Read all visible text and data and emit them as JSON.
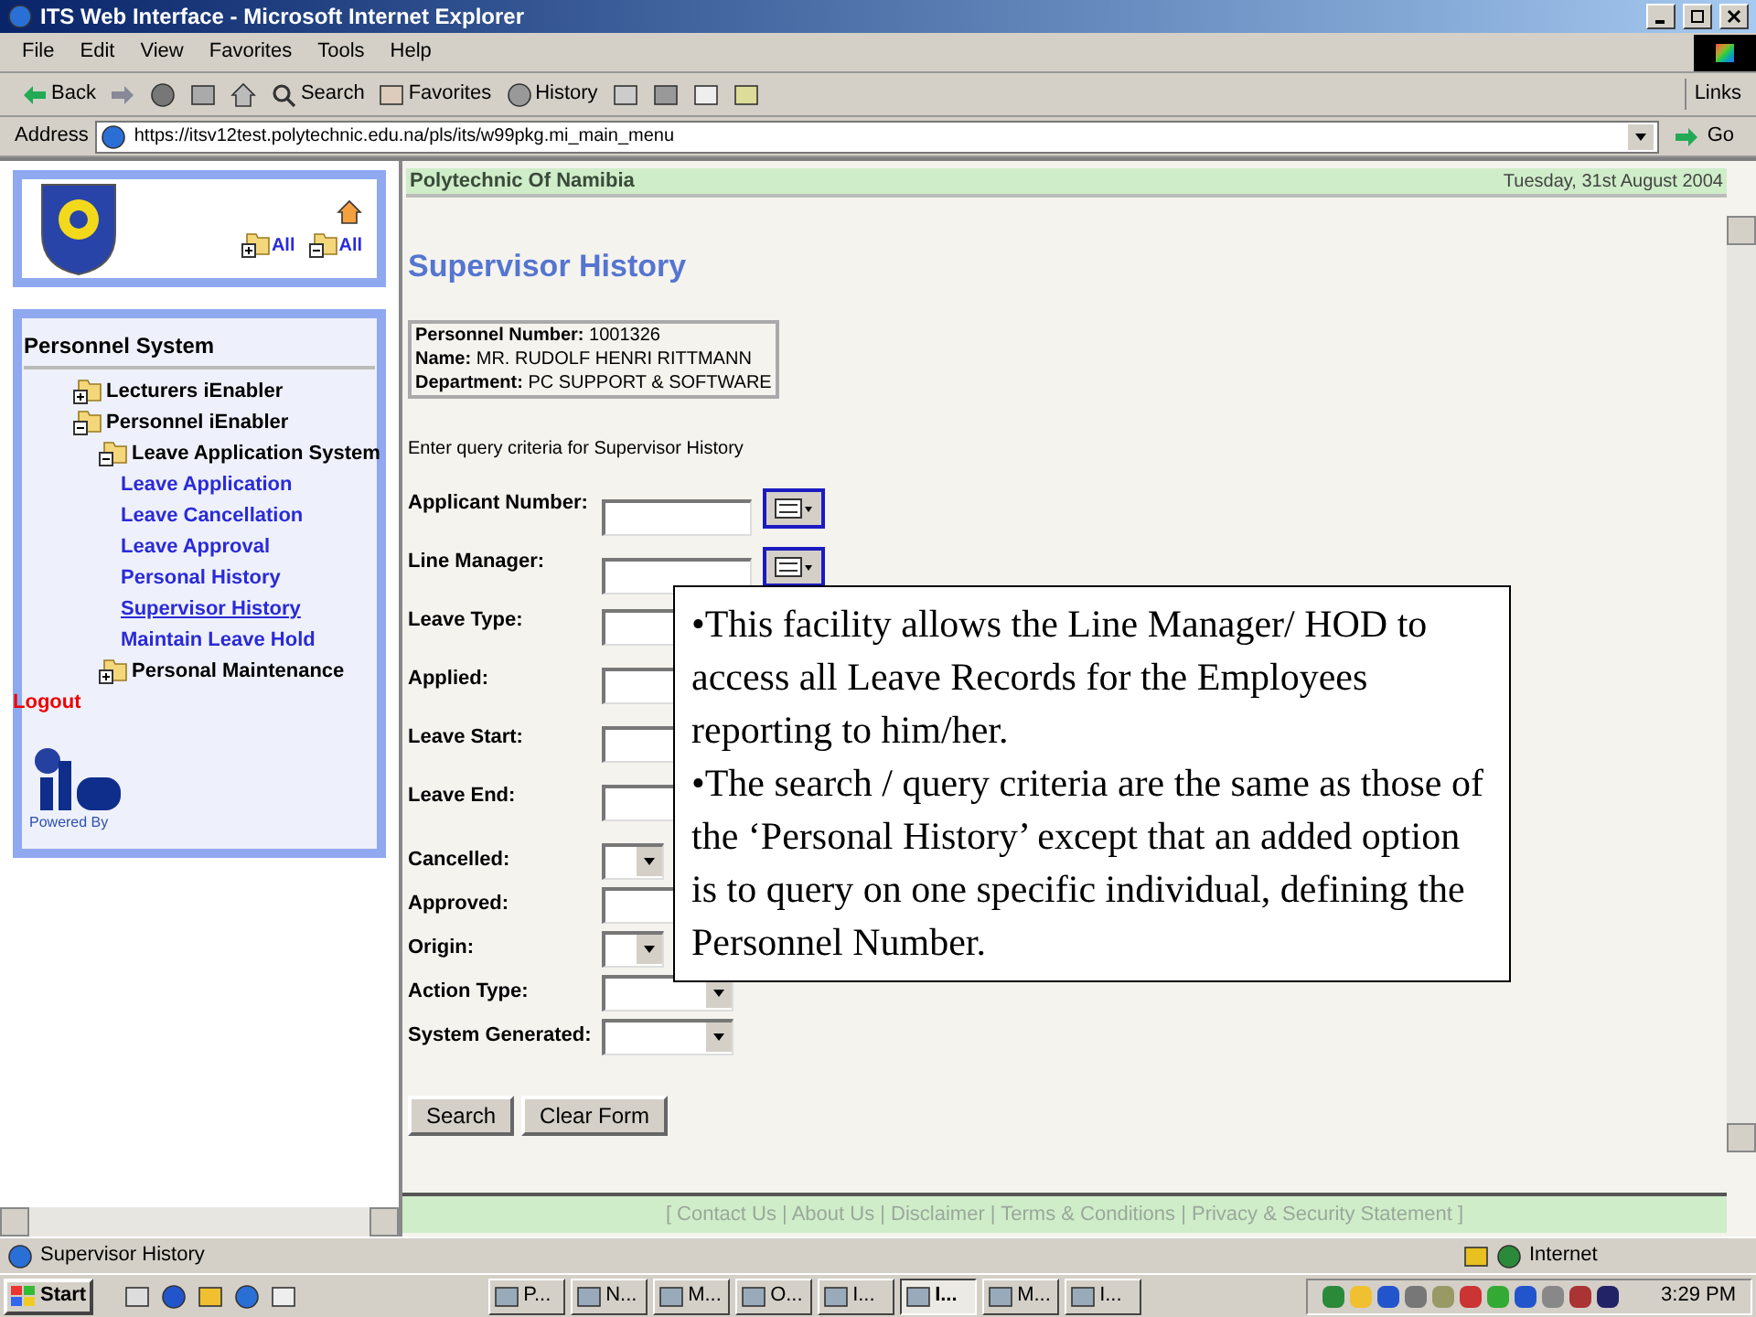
{
  "window": {
    "title": "ITS Web Interface - Microsoft Internet Explorer"
  },
  "menu": [
    "File",
    "Edit",
    "View",
    "Favorites",
    "Tools",
    "Help"
  ],
  "toolbar": [
    {
      "kind": "back",
      "label": "Back"
    },
    {
      "kind": "forward"
    },
    {
      "kind": "stop"
    },
    {
      "kind": "refresh"
    },
    {
      "kind": "home"
    },
    {
      "kind": "search",
      "label": "Search"
    },
    {
      "kind": "favorites",
      "label": "Favorites"
    },
    {
      "kind": "history",
      "label": "History"
    },
    {
      "kind": "mail"
    },
    {
      "kind": "print"
    },
    {
      "kind": "edit"
    },
    {
      "kind": "discuss"
    }
  ],
  "links": "Links",
  "address": {
    "label": "Address",
    "url": "https://itsv12test.polytechnic.edu.na/pls/its/w99pkg.mi_main_menu",
    "go": "Go"
  },
  "sidebar": {
    "expand_all": "All",
    "collapse_all": "All",
    "title": "Personnel System",
    "tree": [
      {
        "kind": "folder",
        "label": "Lecturers iEnabler",
        "expanded": false
      },
      {
        "kind": "folder",
        "label": "Personnel iEnabler",
        "expanded": true,
        "children": [
          {
            "kind": "folder",
            "label": "Leave Application System",
            "expanded": true,
            "children": [
              {
                "kind": "link",
                "label": "Leave Application",
                "selected": false
              },
              {
                "kind": "link",
                "label": "Leave Cancellation",
                "selected": false
              },
              {
                "kind": "link",
                "label": "Leave Approval",
                "selected": false
              },
              {
                "kind": "link",
                "label": "Personal History",
                "selected": false
              },
              {
                "kind": "link",
                "label": "Supervisor History",
                "selected": true
              },
              {
                "kind": "link",
                "label": "Maintain Leave Hold",
                "selected": false
              }
            ]
          },
          {
            "kind": "folder",
            "label": "Personal Maintenance",
            "expanded": false
          }
        ]
      }
    ],
    "logout": "Logout",
    "powered_by": "Powered By"
  },
  "main": {
    "org": "Polytechnic Of Namibia",
    "date": "Tuesday, 31st August 2004",
    "page_title": "Supervisor History",
    "info": [
      {
        "label": "Personnel Number:",
        "value": "1001326"
      },
      {
        "label": "Name:",
        "value": "MR. RUDOLF HENRI RITTMANN"
      },
      {
        "label": "Department:",
        "value": "PC SUPPORT & SOFTWARE"
      }
    ],
    "instruction": "Enter query criteria for Supervisor History",
    "fields": [
      {
        "label": "Applicant Number:",
        "kind": "lookup"
      },
      {
        "label": "Line Manager:",
        "kind": "lookup"
      },
      {
        "label": "Leave Type:",
        "kind": "text"
      },
      {
        "label": "Applied:",
        "kind": "text"
      },
      {
        "label": "Leave Start:",
        "kind": "text"
      },
      {
        "label": "Leave End:",
        "kind": "text"
      },
      {
        "label": "Cancelled:",
        "kind": "select_narrow"
      },
      {
        "label": "Approved:",
        "kind": "text_small"
      },
      {
        "label": "Origin:",
        "kind": "select_narrow"
      },
      {
        "label": "Action Type:",
        "kind": "select"
      },
      {
        "label": "System Generated:",
        "kind": "select"
      }
    ],
    "buttons": [
      "Search",
      "Clear Form"
    ],
    "footer": "[ Contact Us | About Us | Disclaimer | Terms & Conditions | Privacy & Security Statement ]"
  },
  "callout": [
    "•This facility allows the Line Manager/ HOD to access all Leave Records for the Employees reporting to him/her.",
    "•The search / query criteria are the same as those of the ‘Personal History’ except that an added option is to query on one specific individual, defining the Personnel Number."
  ],
  "status_bar": {
    "text": "Supervisor History",
    "zone": "Internet"
  },
  "taskbar": {
    "start": "Start",
    "tasks": [
      {
        "label": "P...",
        "selected": false
      },
      {
        "label": "N...",
        "selected": false
      },
      {
        "label": "M...",
        "selected": false
      },
      {
        "label": "O...",
        "selected": false
      },
      {
        "label": "I...",
        "selected": false
      },
      {
        "label": "I...",
        "selected": true
      },
      {
        "label": "M...",
        "selected": false
      },
      {
        "label": "I...",
        "selected": false
      }
    ],
    "clock": "3:29 PM"
  }
}
